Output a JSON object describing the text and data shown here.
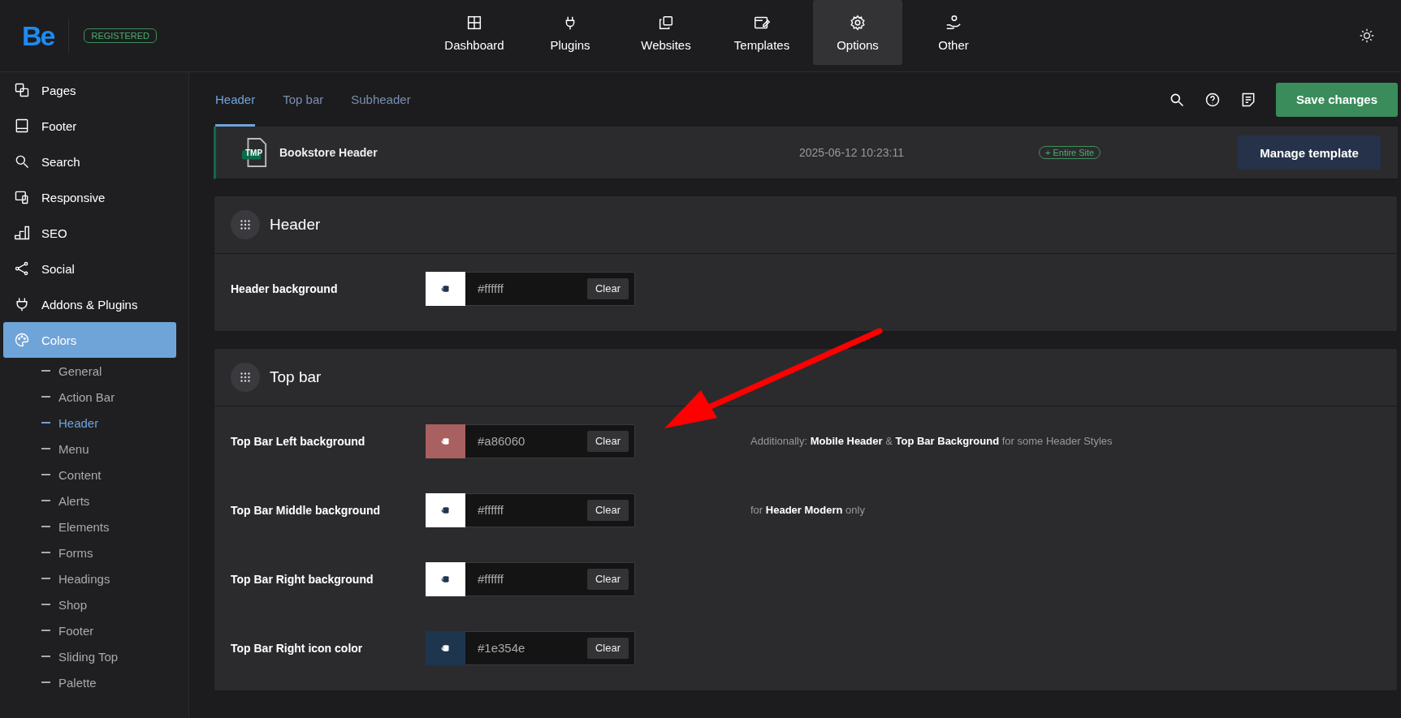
{
  "brand": {
    "logo": "Be",
    "badge": "REGISTERED"
  },
  "nav": [
    {
      "label": "Dashboard",
      "selected": false
    },
    {
      "label": "Plugins",
      "selected": false
    },
    {
      "label": "Websites",
      "selected": false
    },
    {
      "label": "Templates",
      "selected": false
    },
    {
      "label": "Options",
      "selected": true
    },
    {
      "label": "Other",
      "selected": false
    }
  ],
  "sidebar": {
    "items": [
      {
        "label": "Pages",
        "selected": false
      },
      {
        "label": "Footer",
        "selected": false
      },
      {
        "label": "Search",
        "selected": false
      },
      {
        "label": "Responsive",
        "selected": false
      },
      {
        "label": "SEO",
        "selected": false
      },
      {
        "label": "Social",
        "selected": false
      },
      {
        "label": "Addons & Plugins",
        "selected": false
      },
      {
        "label": "Colors",
        "selected": true,
        "children": [
          {
            "label": "General",
            "selected": false
          },
          {
            "label": "Action Bar",
            "selected": false
          },
          {
            "label": "Header",
            "selected": true
          },
          {
            "label": "Menu",
            "selected": false
          },
          {
            "label": "Content",
            "selected": false
          },
          {
            "label": "Alerts",
            "selected": false
          },
          {
            "label": "Elements",
            "selected": false
          },
          {
            "label": "Forms",
            "selected": false
          },
          {
            "label": "Headings",
            "selected": false
          },
          {
            "label": "Shop",
            "selected": false
          },
          {
            "label": "Footer",
            "selected": false
          },
          {
            "label": "Sliding Top",
            "selected": false
          },
          {
            "label": "Palette",
            "selected": false
          }
        ]
      }
    ]
  },
  "tabs": [
    {
      "label": "Header",
      "selected": true
    },
    {
      "label": "Top bar",
      "selected": false
    },
    {
      "label": "Subheader",
      "selected": false
    }
  ],
  "save_button": "Save changes",
  "template": {
    "badge": "TMP",
    "name": "Bookstore Header",
    "date": "2025-06-12 10:23:11",
    "scope": "+ Entire Site",
    "button": "Manage template"
  },
  "sections": [
    {
      "title": "Header",
      "rows": [
        {
          "label": "Header background",
          "color": "#ffffff",
          "value": "#ffffff",
          "clear": "Clear"
        }
      ]
    },
    {
      "title": "Top bar",
      "rows": [
        {
          "label": "Top Bar Left background",
          "color": "#a86060",
          "value": "#a86060",
          "clear": "Clear",
          "hint": "Additionally: **Mobile Header** & **Top Bar Background** for some Header Styles"
        },
        {
          "label": "Top Bar Middle background",
          "color": "#ffffff",
          "value": "#ffffff",
          "clear": "Clear",
          "hint": "for **Header Modern** only"
        },
        {
          "label": "Top Bar Right background",
          "color": "#ffffff",
          "value": "#ffffff",
          "clear": "Clear"
        },
        {
          "label": "Top Bar Right icon color",
          "color": "#1e354e",
          "value": "#1e354e",
          "clear": "Clear"
        }
      ]
    }
  ]
}
